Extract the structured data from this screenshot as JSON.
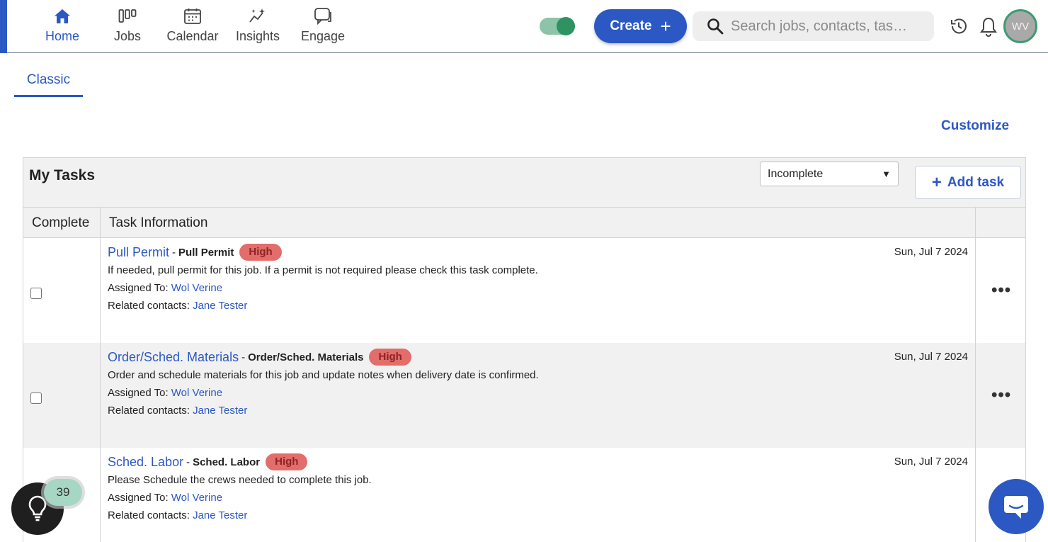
{
  "nav": {
    "items": [
      {
        "label": "Home",
        "icon": "home-icon",
        "active": true
      },
      {
        "label": "Jobs",
        "icon": "jobs-board-icon"
      },
      {
        "label": "Calendar",
        "icon": "calendar-icon"
      },
      {
        "label": "Insights",
        "icon": "insights-icon"
      },
      {
        "label": "Engage",
        "icon": "chat-bubbles-icon"
      }
    ],
    "toggle_on": true,
    "create_label": "Create",
    "search_placeholder": "Search jobs, contacts, tas…",
    "avatar_initials": "WV"
  },
  "colors": {
    "brand": "#2c58c4",
    "toggle": "#2e9361",
    "priority_high": "#e26d6b",
    "avatar_ring": "#3f9a74"
  },
  "tabs": [
    {
      "label": "Classic",
      "active": true
    }
  ],
  "customize_label": "Customize",
  "tasks_panel": {
    "title": "My Tasks",
    "filter_value": "Incomplete",
    "add_task_label": "Add task",
    "columns": {
      "complete": "Complete",
      "info": "Task Information"
    },
    "assigned_label": "Assigned To:",
    "related_label": "Related contacts:",
    "tasks": [
      {
        "name": "Pull Permit",
        "type": "Pull Permit",
        "priority": "High",
        "date": "Sun, Jul 7 2024",
        "description": "If needed, pull permit for this job. If a permit is not required please check this task complete.",
        "assigned_to": "Wol Verine",
        "related_contact": "Jane Tester",
        "completed": false
      },
      {
        "name": "Order/Sched. Materials",
        "type": "Order/Sched. Materials",
        "priority": "High",
        "date": "Sun, Jul 7 2024",
        "description": "Order and schedule materials for this job and update notes when delivery date is confirmed.",
        "assigned_to": "Wol Verine",
        "related_contact": "Jane Tester",
        "completed": false
      },
      {
        "name": "Sched. Labor",
        "type": "Sched. Labor",
        "priority": "High",
        "date": "Sun, Jul 7 2024",
        "description": "Please Schedule the crews needed to complete this job.",
        "assigned_to": "Wol Verine",
        "related_contact": "Jane Tester",
        "completed": false
      }
    ]
  },
  "tips_count": "39"
}
